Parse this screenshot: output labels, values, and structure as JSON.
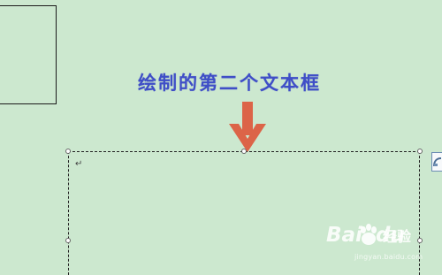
{
  "canvas": {
    "background": "#cce8cf"
  },
  "caption": {
    "text": "绘制的第二个文本框",
    "color": "#3f4ec7"
  },
  "arrow": {
    "color": "#dc6448",
    "icon": "arrow-down-icon"
  },
  "textbox": {
    "paragraph_mark": "↵"
  },
  "layout_options": {
    "icon": "layout-options-icon"
  },
  "watermark": {
    "bai": "Bai",
    "du": "du",
    "jingyan": "经验",
    "url": "jingyan.baidu.com"
  }
}
